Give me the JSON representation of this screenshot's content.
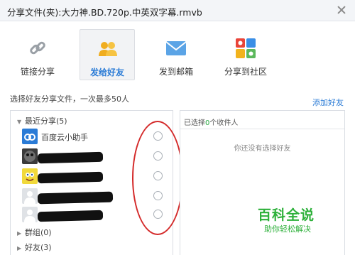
{
  "dialog": {
    "title": "分享文件(夹):大力神.BD.720p.中英双字幕.rmvb"
  },
  "tabs": [
    {
      "label": "链接分享",
      "icon": "link-icon"
    },
    {
      "label": "发给好友",
      "icon": "friends-icon",
      "active": true
    },
    {
      "label": "发到邮箱",
      "icon": "envelope-icon"
    },
    {
      "label": "分享到社区",
      "icon": "community-icon"
    }
  ],
  "hint": "选择好友分享文件，一次最多50人",
  "add_friend": "添加好友",
  "groups": {
    "recent": {
      "label": "最近分享(5)"
    },
    "groups": {
      "label": "群组(0)"
    },
    "friends": {
      "label": "好友(3)"
    }
  },
  "recent_items": [
    {
      "name": "百度云小助手"
    },
    {
      "name": ""
    },
    {
      "name": ""
    },
    {
      "name": ""
    },
    {
      "name": ""
    }
  ],
  "selected": {
    "prefix": "已选择",
    "count": "0",
    "suffix": "个收件人"
  },
  "empty_text": "你还没有选择好友",
  "watermark": {
    "title": "百科全说",
    "subtitle": "助你轻松解决"
  },
  "colors": {
    "accent": "#2a7bd6",
    "annotation": "#d42a2a",
    "watermark": "#2db03a"
  }
}
